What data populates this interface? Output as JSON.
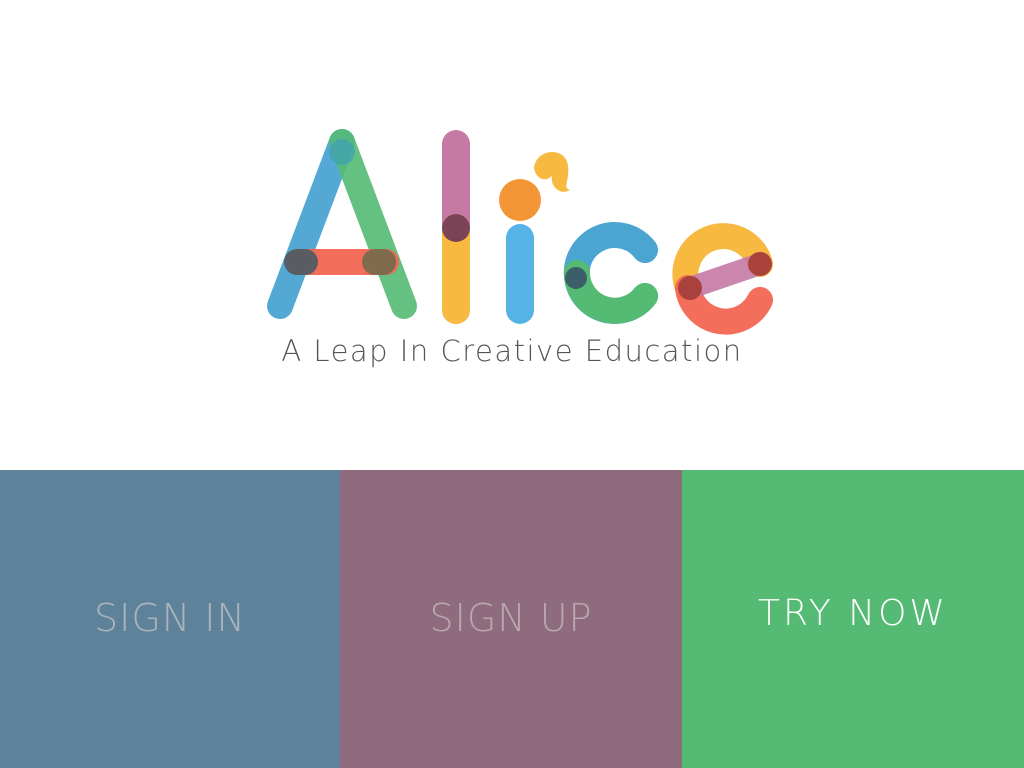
{
  "brand": {
    "logo_text": "Alice",
    "tagline": "A Leap In Creative Education"
  },
  "actions": [
    {
      "label": "SIGN IN",
      "background": "#5f829b",
      "text_color": "#aab4bc"
    },
    {
      "label": "SIGN UP",
      "background": "#8e6c7d",
      "text_color": "#b9a7b1"
    },
    {
      "label": "TRY NOW",
      "background": "#55bb74",
      "text_color": "#ffffff"
    }
  ],
  "colors": {
    "background": "#ffffff",
    "tagline": "#555555",
    "logo_blue": "#4aa5d1",
    "logo_green": "#55bb74",
    "logo_red": "#f26652",
    "logo_pink": "#c57aa4",
    "logo_yellow": "#f8b941",
    "logo_orange": "#f39534",
    "logo_sky": "#55b3e6"
  }
}
